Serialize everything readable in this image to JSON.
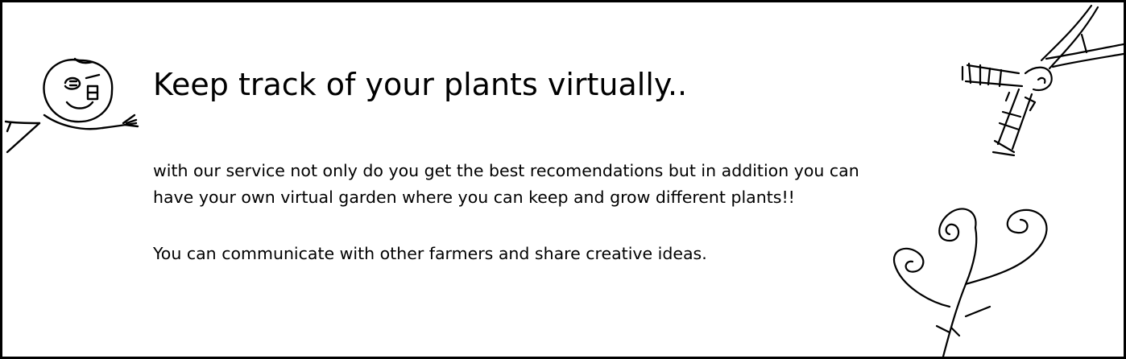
{
  "title": "Keep track of your plants virtually..",
  "paragraph1": {
    "line1": "with our service not only do you get the best recomendations but in addition you can",
    "line2": "have your own virtual garden where you can keep and grow different plants!!"
  },
  "paragraph2": "You can communicate with other farmers and share creative ideas.",
  "colors": {
    "ink": "#000000",
    "background": "#ffffff"
  },
  "icons": [
    "stick-figure-doodle",
    "branch-doodle",
    "curly-plant-doodle"
  ]
}
